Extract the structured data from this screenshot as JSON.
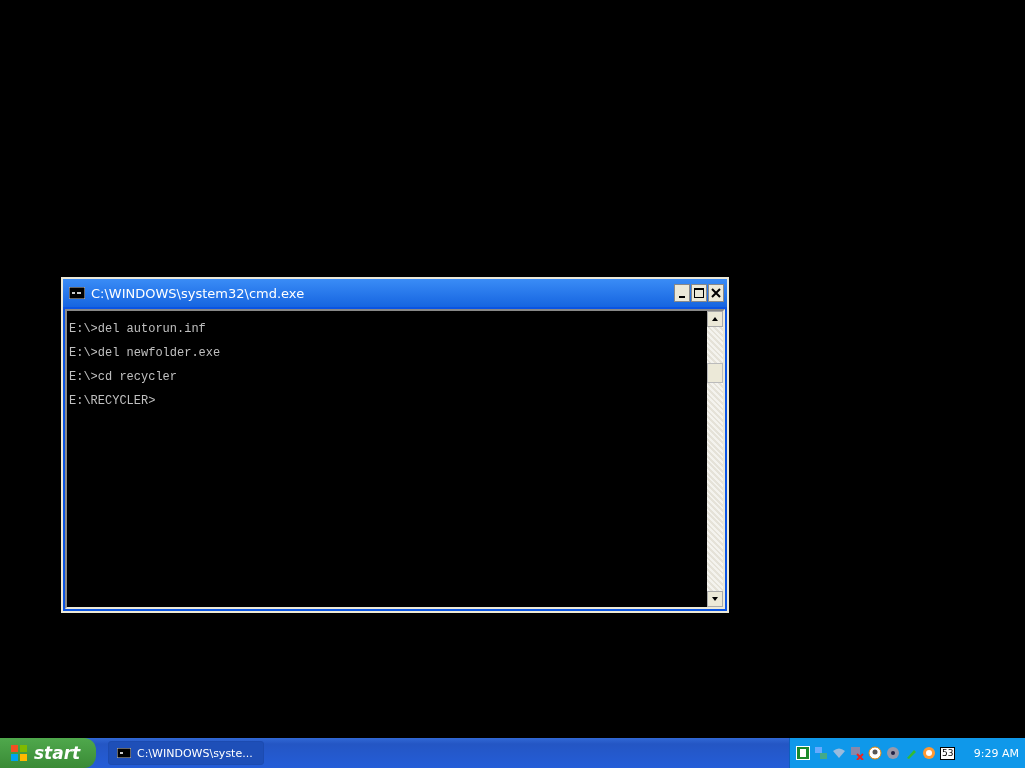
{
  "window": {
    "title": "C:\\WINDOWS\\system32\\cmd.exe",
    "lines": [
      "E:\\>del autorun.inf",
      "E:\\>del newfolder.exe",
      "E:\\>cd recycler",
      "E:\\RECYCLER>"
    ]
  },
  "taskbar": {
    "start_label": "start",
    "tasks": [
      {
        "label": "C:\\WINDOWS\\syste...",
        "selected": true
      }
    ],
    "tray_calendar_text": "53",
    "clock": "9:29 AM"
  }
}
